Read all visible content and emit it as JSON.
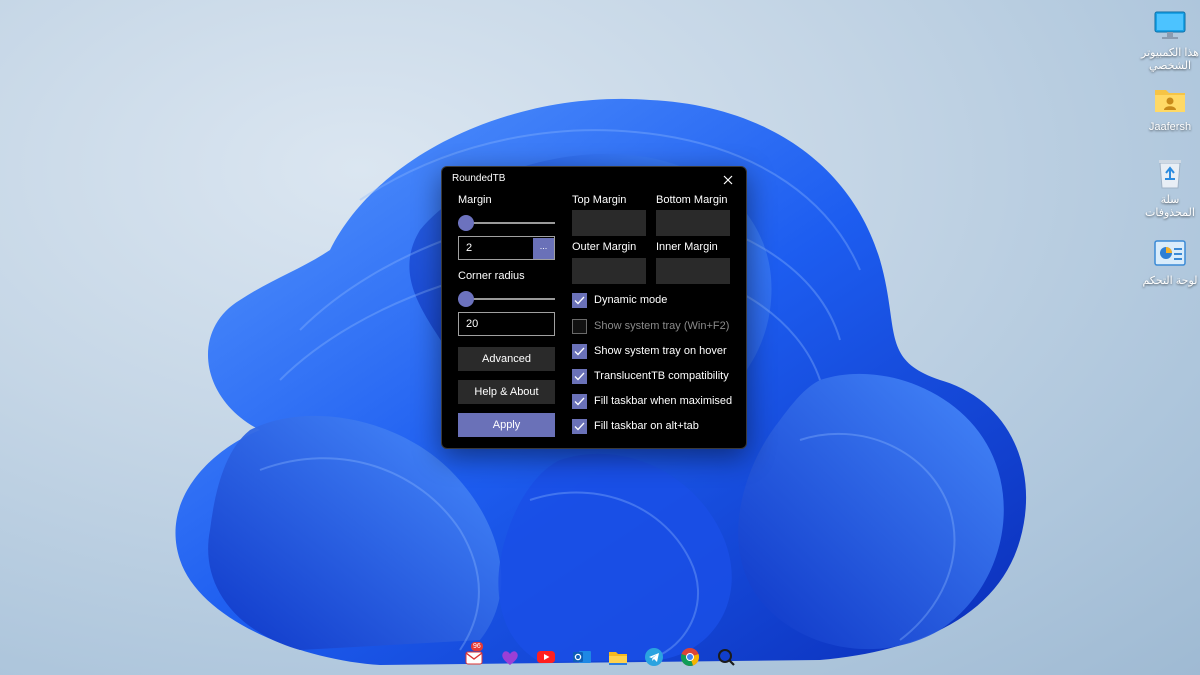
{
  "desktop": {
    "icons": [
      {
        "label": "هذا الكمبيوتر الشخصي",
        "icon": "monitor-icon"
      },
      {
        "label": "Jaafersh",
        "icon": "user-folder-icon"
      },
      {
        "label": "سلة المحذوفات",
        "icon": "recycle-bin-icon"
      },
      {
        "label": "لوحة التحكم",
        "icon": "control-panel-icon"
      }
    ]
  },
  "window": {
    "title": "RoundedTB",
    "margin_label": "Margin",
    "margin_value": "2",
    "browse_label": "...",
    "corner_radius_label": "Corner radius",
    "corner_radius_value": "20",
    "advanced_label": "Advanced",
    "help_label": "Help & About",
    "apply_label": "Apply",
    "top_margin_label": "Top Margin",
    "bottom_margin_label": "Bottom Margin",
    "outer_margin_label": "Outer Margin",
    "inner_margin_label": "Inner Margin",
    "options": [
      {
        "label": "Dynamic mode",
        "checked": true,
        "enabled": true
      },
      {
        "label": "Show system tray (Win+F2)",
        "checked": false,
        "enabled": false
      },
      {
        "label": "Show system tray on hover",
        "checked": true,
        "enabled": true
      },
      {
        "label": "TranslucentTB compatibility",
        "checked": true,
        "enabled": true
      },
      {
        "label": "Fill taskbar when maximised",
        "checked": true,
        "enabled": true
      },
      {
        "label": "Fill taskbar on alt+tab",
        "checked": true,
        "enabled": true
      }
    ]
  },
  "taskbar": {
    "items": [
      {
        "name": "mail-app-icon",
        "badge": "96"
      },
      {
        "name": "heart-app-icon"
      },
      {
        "name": "youtube-icon"
      },
      {
        "name": "outlook-icon"
      },
      {
        "name": "file-explorer-icon"
      },
      {
        "name": "telegram-icon"
      },
      {
        "name": "chrome-icon"
      },
      {
        "name": "search-icon"
      }
    ]
  },
  "colors": {
    "accent": "#6a71b8",
    "window_bg": "#000000",
    "field_bg": "#2a2a2a"
  }
}
